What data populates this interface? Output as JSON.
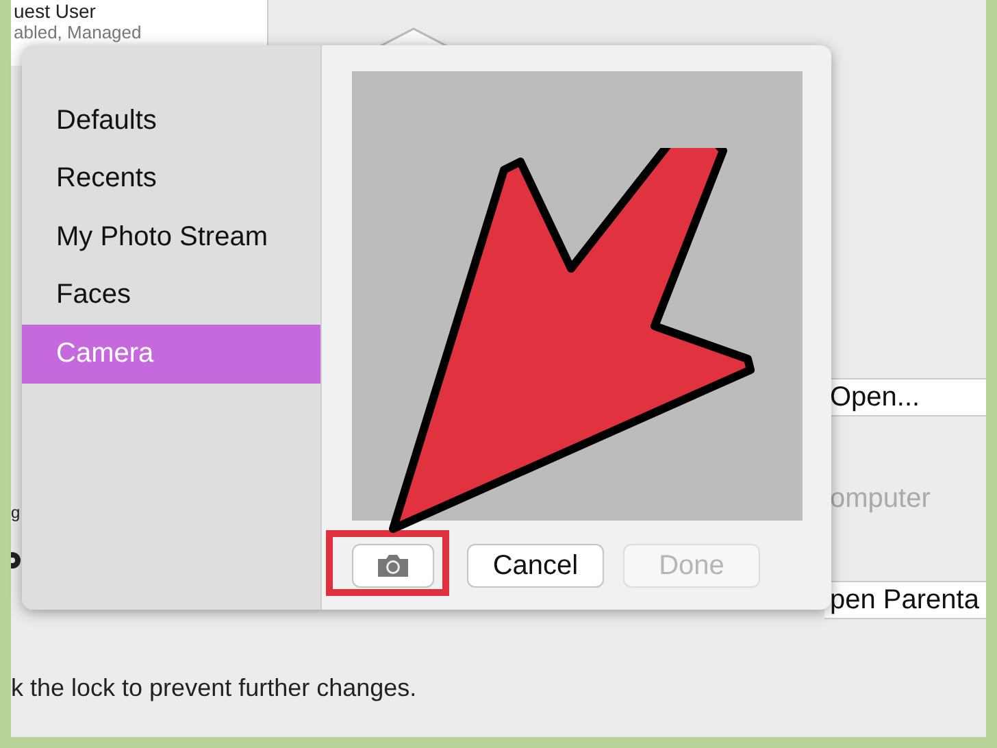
{
  "background": {
    "user_name": "uest User",
    "user_status": "abled, Managed",
    "buttons": [
      {
        "label": "Open...",
        "disabled": false
      },
      {
        "label": "omputer",
        "disabled": true
      },
      {
        "label": "pen Parenta",
        "disabled": false
      }
    ],
    "left_fragment": "g",
    "footer_text": "k the lock to prevent further changes."
  },
  "popover": {
    "sources": [
      {
        "label": "Defaults",
        "selected": false
      },
      {
        "label": "Recents",
        "selected": false
      },
      {
        "label": "My Photo Stream",
        "selected": false
      },
      {
        "label": "Faces",
        "selected": false
      },
      {
        "label": "Camera",
        "selected": true
      }
    ],
    "buttons": [
      {
        "kind": "camera",
        "disabled": false
      },
      {
        "kind": "text",
        "label": "Cancel",
        "disabled": false
      },
      {
        "kind": "text",
        "label": "Done",
        "disabled": true
      }
    ]
  }
}
